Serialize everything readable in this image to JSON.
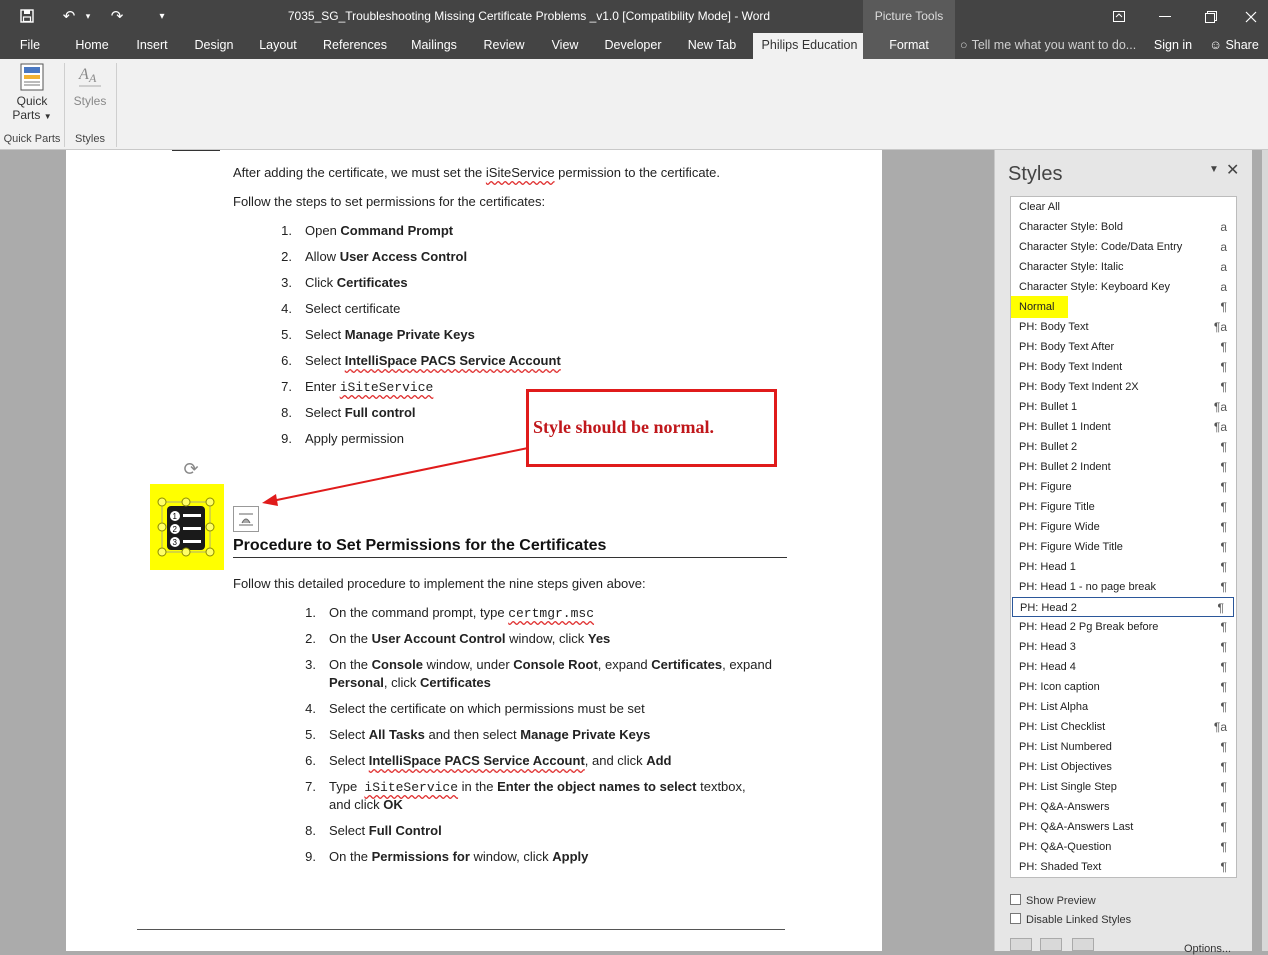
{
  "window": {
    "title": "7035_SG_Troubleshooting Missing Certificate Problems _v1.0 [Compatibility Mode] - Word",
    "picture_tools_label": "Picture Tools"
  },
  "tabs": {
    "file": "File",
    "home": "Home",
    "insert": "Insert",
    "design": "Design",
    "layout": "Layout",
    "references": "References",
    "mailings": "Mailings",
    "review": "Review",
    "view": "View",
    "developer": "Developer",
    "new_tab": "New Tab",
    "philips": "Philips Education",
    "format": "Format",
    "tell_me": "Tell me what you want to do...",
    "sign_in": "Sign in",
    "share": "Share"
  },
  "ribbon": {
    "quick_parts_line1": "Quick",
    "quick_parts_line2": "Parts",
    "styles_btn": "Styles",
    "group_quick_parts": "Quick Parts",
    "group_styles": "Styles"
  },
  "document": {
    "intro1_pre": "After adding the certificate, we must set the ",
    "intro1_word": "iSiteService",
    "intro1_post": " permission to the certificate.",
    "intro2": "Follow the steps to set permissions for the certificates:",
    "steps1": [
      {
        "num": "1.",
        "pre": "Open ",
        "bold": "Command Prompt"
      },
      {
        "num": "2.",
        "pre": "Allow ",
        "bold": "User Access Control"
      },
      {
        "num": "3.",
        "pre": "Click ",
        "bold": "Certificates"
      },
      {
        "num": "4.",
        "pre": "Select certificate",
        "bold": ""
      },
      {
        "num": "5.",
        "pre": "Select ",
        "bold": "Manage Private Keys"
      },
      {
        "num": "6.",
        "pre": "Select ",
        "bold": "IntelliSpace PACS Service Account"
      },
      {
        "num": "7.",
        "pre": "Enter ",
        "code": "iSiteService"
      },
      {
        "num": "8.",
        "pre": "Select ",
        "bold": "Full control"
      },
      {
        "num": "9.",
        "pre": "Apply permission",
        "bold": ""
      }
    ],
    "callout": "Style should be normal.",
    "heading": "Procedure to Set Permissions for the Certificates",
    "intro3": "Follow this detailed procedure to implement the nine steps given above:",
    "steps2": {
      "s1_num": "1.",
      "s1_pre": "On the command prompt, type ",
      "s1_code": "certmgr.msc",
      "s2_num": "2.",
      "s2_pre": "On the ",
      "s2_b1": "User Account Control",
      "s2_mid": " window, click ",
      "s2_b2": "Yes",
      "s3_num": "3.",
      "s3_pre": "On the ",
      "s3_b1": "Console",
      "s3_mid1": " window, under ",
      "s3_b2": "Console Root",
      "s3_mid2": ", expand ",
      "s3_b3": "Certificates",
      "s3_mid3": ", expand",
      "s3_l2_b": "Personal",
      "s3_l2_mid": ", click ",
      "s3_l2_b2": "Certificates",
      "s4_num": "4.",
      "s4_txt": "Select the certificate on which permissions must be set",
      "s5_num": "5.",
      "s5_pre": "Select ",
      "s5_b1": "All Tasks",
      "s5_mid": " and then select ",
      "s5_b2": "Manage Private Keys",
      "s6_num": "6.",
      "s6_pre": "Select ",
      "s6_b1": "IntelliSpace PACS Service Account",
      "s6_mid": ", and click ",
      "s6_b2": "Add",
      "s7_num": "7.",
      "s7_pre": "Type  ",
      "s7_code": "iSiteService",
      "s7_mid": " in the ",
      "s7_b1": "Enter the object names to select",
      "s7_post": " textbox,",
      "s7_l2_pre": "and click ",
      "s7_l2_b": "OK",
      "s8_num": "8.",
      "s8_pre": "Select ",
      "s8_b": "Full Control",
      "s9_num": "9.",
      "s9_pre": "On the ",
      "s9_b1": "Permissions for",
      "s9_mid": " window, click ",
      "s9_b2": "Apply"
    }
  },
  "styles_pane": {
    "title": "Styles",
    "items": [
      {
        "name": "Clear All",
        "mark": ""
      },
      {
        "name": "Character Style: Bold",
        "mark": "a"
      },
      {
        "name": "Character Style: Code/Data Entry",
        "mark": "a"
      },
      {
        "name": "Character Style: Italic",
        "mark": "a"
      },
      {
        "name": "Character Style: Keyboard Key",
        "mark": "a"
      },
      {
        "name": "Normal",
        "mark": "¶"
      },
      {
        "name": "PH: Body Text",
        "mark": "¶a"
      },
      {
        "name": "PH: Body Text After",
        "mark": "¶"
      },
      {
        "name": "PH: Body Text Indent",
        "mark": "¶"
      },
      {
        "name": "PH: Body Text Indent 2X",
        "mark": "¶"
      },
      {
        "name": "PH: Bullet 1",
        "mark": "¶a"
      },
      {
        "name": "PH: Bullet 1 Indent",
        "mark": "¶a"
      },
      {
        "name": "PH: Bullet 2",
        "mark": "¶"
      },
      {
        "name": "PH: Bullet 2 Indent",
        "mark": "¶"
      },
      {
        "name": "PH: Figure",
        "mark": "¶"
      },
      {
        "name": "PH: Figure Title",
        "mark": "¶"
      },
      {
        "name": "PH: Figure Wide",
        "mark": "¶"
      },
      {
        "name": "PH: Figure Wide Title",
        "mark": "¶"
      },
      {
        "name": "PH: Head 1",
        "mark": "¶"
      },
      {
        "name": "PH: Head 1 - no page break",
        "mark": "¶"
      },
      {
        "name": "PH: Head 2",
        "mark": "¶"
      },
      {
        "name": "PH: Head 2 Pg Break before",
        "mark": "¶"
      },
      {
        "name": "PH: Head 3",
        "mark": "¶"
      },
      {
        "name": "PH: Head 4",
        "mark": "¶"
      },
      {
        "name": "PH: Icon caption",
        "mark": "¶"
      },
      {
        "name": "PH: List Alpha",
        "mark": "¶"
      },
      {
        "name": "PH: List Checklist",
        "mark": "¶a"
      },
      {
        "name": "PH: List Numbered",
        "mark": "¶"
      },
      {
        "name": "PH: List Objectives",
        "mark": "¶"
      },
      {
        "name": "PH: List Single Step",
        "mark": "¶"
      },
      {
        "name": "PH: Q&A-Answers",
        "mark": "¶"
      },
      {
        "name": "PH: Q&A-Answers Last",
        "mark": "¶"
      },
      {
        "name": "PH: Q&A-Question",
        "mark": "¶"
      },
      {
        "name": "PH: Shaded Text",
        "mark": "¶"
      }
    ],
    "show_preview": "Show Preview",
    "disable_linked": "Disable Linked Styles",
    "options": "Options..."
  }
}
